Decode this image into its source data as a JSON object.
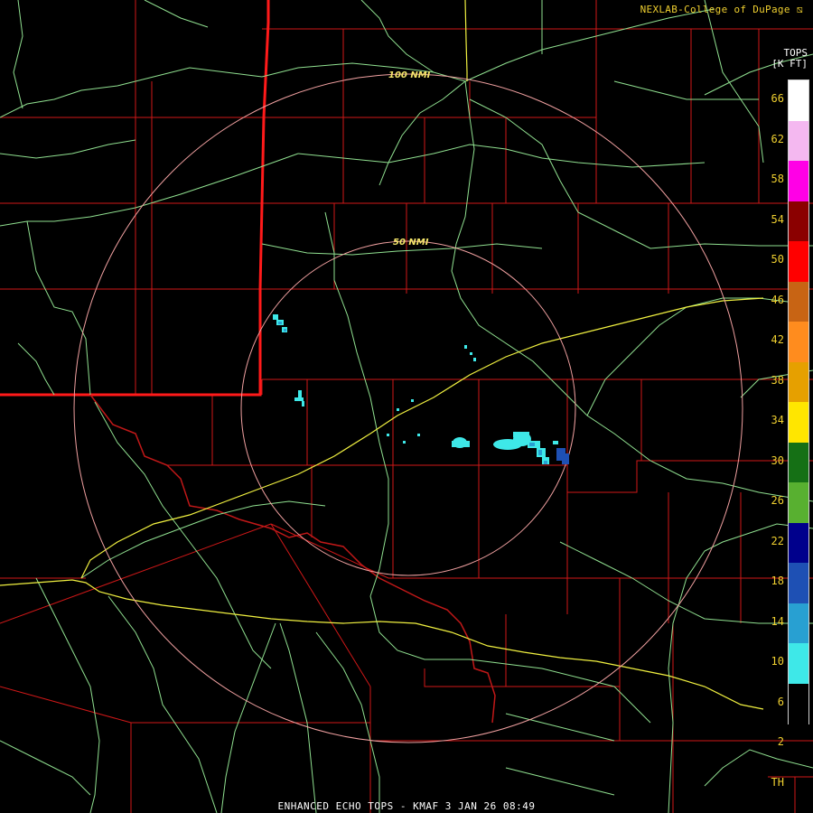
{
  "header": {
    "credit": "NEXLAB-College of DuPage"
  },
  "footer": {
    "caption": "ENHANCED ECHO TOPS - KMAF 3 JAN 26 08:49"
  },
  "rings": {
    "inner_label": "50 NMI",
    "outer_label": "100 NMI"
  },
  "legend": {
    "title_line1": "TOPS",
    "title_line2": "[K FT]",
    "ticks": [
      "66",
      "62",
      "58",
      "54",
      "50",
      "46",
      "42",
      "38",
      "34",
      "30",
      "26",
      "22",
      "18",
      "14",
      "10",
      "6",
      "2",
      "TH"
    ],
    "colors": [
      "#ffffff",
      "#f4b8f0",
      "#ff00e6",
      "#8b0000",
      "#ff0000",
      "#c86414",
      "#ff8c1e",
      "#e6a000",
      "#ffe600",
      "#157015",
      "#58b030",
      "#00008c",
      "#1e50b4",
      "#28a0d2",
      "#3ee8e8",
      "#000000"
    ]
  },
  "colors": {
    "county_lines": "#d01818",
    "state_line": "#ff1a1a",
    "highways": "#f0f040",
    "rivers": "#90e090",
    "range_rings": "#f0a0a0",
    "echo_light": "#3ee8e8",
    "echo_mid": "#28a0d2",
    "echo_dark": "#1e50b4"
  }
}
